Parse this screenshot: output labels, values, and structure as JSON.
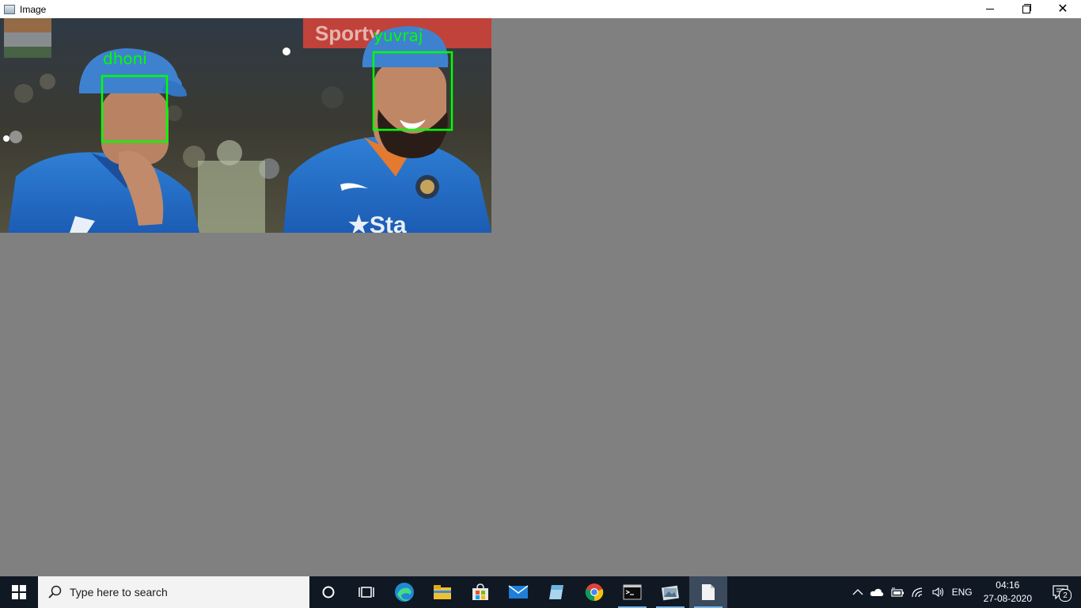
{
  "window": {
    "title": "Image",
    "minimize_label": "—",
    "maximize_label": "",
    "close_label": "✕"
  },
  "image": {
    "labels": [
      {
        "name": "dhoni"
      },
      {
        "name": "yuvraj"
      }
    ],
    "box_color": "#00ff00",
    "background_banner_text": "Sporty"
  },
  "taskbar": {
    "search_placeholder": "Type here to search",
    "apps": [
      "cortana",
      "task-view",
      "edge",
      "file-explorer",
      "store",
      "mail",
      "notepad-app",
      "chrome",
      "terminal",
      "photo-viewer",
      "document"
    ],
    "tray": {
      "language": "ENG",
      "time": "04:16",
      "date": "27-08-2020",
      "notification_count": "2"
    }
  }
}
